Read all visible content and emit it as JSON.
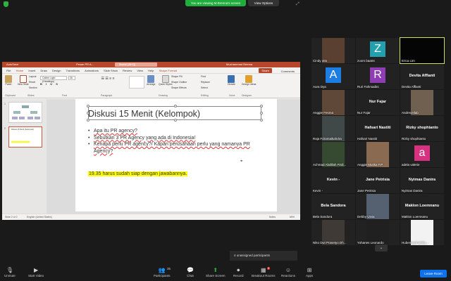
{
  "zoom_bar": {
    "viewing_text": "You are viewing M Brenna's screen",
    "view_options": "View Options"
  },
  "ppt": {
    "autosave": "AutoSave",
    "filename": "Pesan PR A...",
    "search_placeholder": "Search (Alt+Q)",
    "user": "Muchammad Brenna",
    "tabs": [
      "File",
      "Home",
      "Insert",
      "Draw",
      "Design",
      "Transitions",
      "Animations",
      "Slide Show",
      "Review",
      "View",
      "Help",
      "Shape Format"
    ],
    "share_label": "Share",
    "comments_label": "Comments",
    "ribbon": {
      "paste": "Paste",
      "new_slide": "New Slide",
      "layout": "Layout",
      "reset": "Reset",
      "section": "Section",
      "font": "Calibri Light (Headings)",
      "size": "36",
      "groups": [
        "Clipboard",
        "Slides",
        "Font",
        "Paragraph",
        "Drawing",
        "Editing",
        "Voice",
        "Designer"
      ],
      "arrange": "Arrange",
      "quick_styles": "Quick Styles",
      "shape_fill": "Shape Fill",
      "shape_outline": "Shape Outline",
      "shape_effects": "Shape Effects",
      "find": "Find",
      "replace": "Replace",
      "select": "Select",
      "dictate": "Dictate",
      "design_ideas": "Design Ideas"
    },
    "slide": {
      "title": "Diskusi 15 Menit (Kelompok)",
      "bullets": [
        "Apa itu PR agency?",
        "Sebutkan 3 PR Agency yang ada di Indonesia!",
        "Kenapa perlu PR agency?/ Kapan perusahaan perlu yang namanya PR Agency?"
      ],
      "highlight": "19.35 harus sudah siap dengan jawabannya."
    },
    "thumbs": [
      "1",
      "2"
    ],
    "thumb2_text": "Diskusi 15 Menit (Kelompok)",
    "status_left": "Slide 2 of 2",
    "status_lang": "English (United States)",
    "status_notes": "Notes",
    "zoom": "65%"
  },
  "participants": [
    {
      "name": "Cindy otto",
      "type": "photo",
      "color": "#5a4030"
    },
    {
      "name": "zoom baa04",
      "type": "avatar",
      "letter": "Z",
      "color": "#23a0b0"
    },
    {
      "name": "Erica Lim",
      "type": "dark",
      "color": "#050505"
    },
    {
      "name": "Aura Dya",
      "type": "avatar",
      "letter": "A",
      "color": "#1e7de0"
    },
    {
      "name": "Ruri Fahmadini",
      "type": "avatar",
      "letter": "R",
      "color": "#8e3db3"
    },
    {
      "name": "Devita Afflanti",
      "type": "label",
      "label": "Devita Afflanti"
    },
    {
      "name": "Anggie Fesma",
      "type": "photo",
      "color": "#604838"
    },
    {
      "name": "Nur Fajar",
      "type": "label",
      "label": "Nur Fajar"
    },
    {
      "name": "Andrecellab",
      "type": "photo",
      "color": "#706050"
    },
    {
      "name": "Raja Fdramaikahdra",
      "type": "photo",
      "color": "#404848"
    },
    {
      "name": "Hafsari Nastiti",
      "type": "label",
      "label": "Hafsari Nastiti"
    },
    {
      "name": "Rizky shophianto",
      "type": "label",
      "label": "Rizky shophianto"
    },
    {
      "name": "Achmad Abdillah Firdi...",
      "type": "photo",
      "color": "#354a30"
    },
    {
      "name": "Anggie Mutika F.P",
      "type": "photo",
      "color": "#8a6a50"
    },
    {
      "name": "adela valerie",
      "type": "avatar",
      "letter": "a",
      "color": "#d6327f"
    },
    {
      "name": "Kevin -",
      "type": "label",
      "label": "Kevin -"
    },
    {
      "name": "Jane Petrisia",
      "type": "label",
      "label": "Jane Petrisia"
    },
    {
      "name": "Nyimas Danira",
      "type": "label",
      "label": "Nyimas Danira"
    },
    {
      "name": "Bela Sandora",
      "type": "label",
      "label": "Bela Sandora"
    },
    {
      "name": "Debby Utvia",
      "type": "photo",
      "color": "#556070"
    },
    {
      "name": "Maklon Loemnanu",
      "type": "label",
      "label": "Maklon Loemnanu"
    },
    {
      "name": "Niko Dwi Prasetyo Dh...",
      "type": "photo",
      "color": "#403a36"
    },
    {
      "name": "Yohanes Leonardo",
      "type": "photo",
      "color": "#202020"
    },
    {
      "name": "Hubermarif ahilla...",
      "type": "photo",
      "color": "#f2f2f2"
    }
  ],
  "unassigned": "4 unassigned participants",
  "toolbar": {
    "unmute": "Unmute",
    "start_video": "Start Video",
    "participants": "Participants",
    "participants_count": "35",
    "chat": "Chat",
    "share_screen": "Share Screen",
    "record": "Record",
    "breakout": "Breakout Rooms",
    "breakout_badge": "4",
    "reactions": "Reactions",
    "apps": "Apps",
    "leave": "Leave Room"
  },
  "colors": {
    "ppt_red": "#b7472a",
    "zoom_green": "#1fae3d",
    "leave_blue": "#0e72ed",
    "highlight": "#ffff00"
  }
}
